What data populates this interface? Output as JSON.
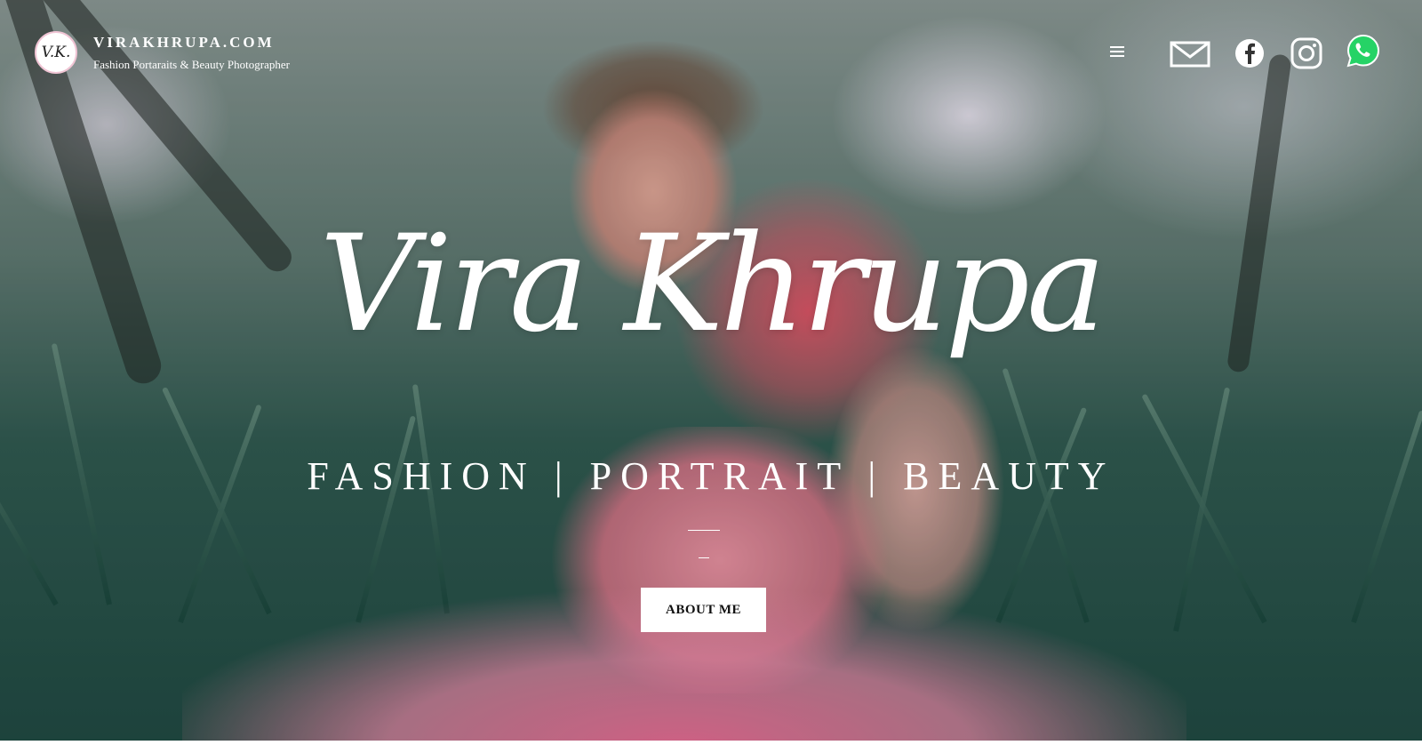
{
  "header": {
    "logo_monogram": "V.K.",
    "site_title": "VIRAKHRUPA.COM",
    "tagline": "Fashion Portaraits & Beauty Photographer",
    "menu_icon": "hamburger-menu-icon",
    "social": [
      {
        "name": "email-icon"
      },
      {
        "name": "facebook-icon"
      },
      {
        "name": "instagram-icon"
      },
      {
        "name": "whatsapp-icon"
      }
    ]
  },
  "hero": {
    "name": "Vira Khrupa",
    "genres": "FASHION | PORTRAIT | BEAUTY",
    "cta_label": "ABOUT ME"
  },
  "colors": {
    "text": "#ffffff",
    "button_bg": "#ffffff",
    "button_text": "#111111",
    "whatsapp": "#25d366",
    "logo_ring": "#f0c4d4"
  }
}
